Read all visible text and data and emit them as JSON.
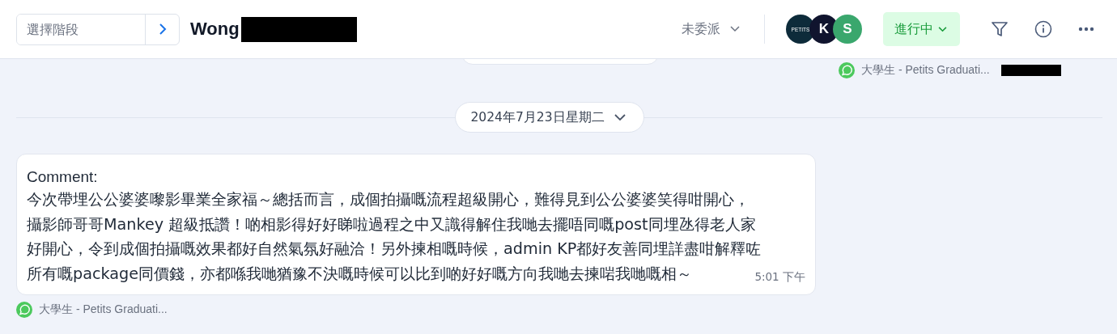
{
  "header": {
    "stage_field": {
      "placeholder": "選擇階段"
    },
    "contact_name": "Wong",
    "assignee": "未委派",
    "avatars": [
      {
        "kind": "logo",
        "label": "PETITS",
        "color": "#0d2b3a"
      },
      {
        "kind": "initial",
        "label": "K",
        "color": "#10142e"
      },
      {
        "kind": "initial",
        "label": "S",
        "color": "#3aa76d"
      }
    ],
    "status": "進行中"
  },
  "previous_message": {
    "source": "大學生 - Petits Graduati..."
  },
  "date_divider": "2024年7月23日星期二",
  "message": {
    "lines": [
      "Comment:",
      "今次帶埋公公婆婆嚟影畢業全家福～總括而言，成個拍攝嘅流程超級開心，難得見到公公婆婆笑得咁開心，",
      "攝影師哥哥Mankey 超級抵讚！啲相影得好好睇啦過程之中又識得解住我哋去擺唔同嘅post同埋氹得老人家",
      "好開心，令到成個拍攝嘅效果都好自然氣氛好融洽！另外揀相嘅時候，admin KP都好友善同埋詳盡咁解釋咗",
      "所有嘅package同價錢，亦都喺我哋猶豫不決嘅時候可以比到啲好好嘅方向我哋去揀啱我哋嘅相～"
    ],
    "time": "5:01 下午",
    "source": "大學生 - Petits Graduati..."
  }
}
